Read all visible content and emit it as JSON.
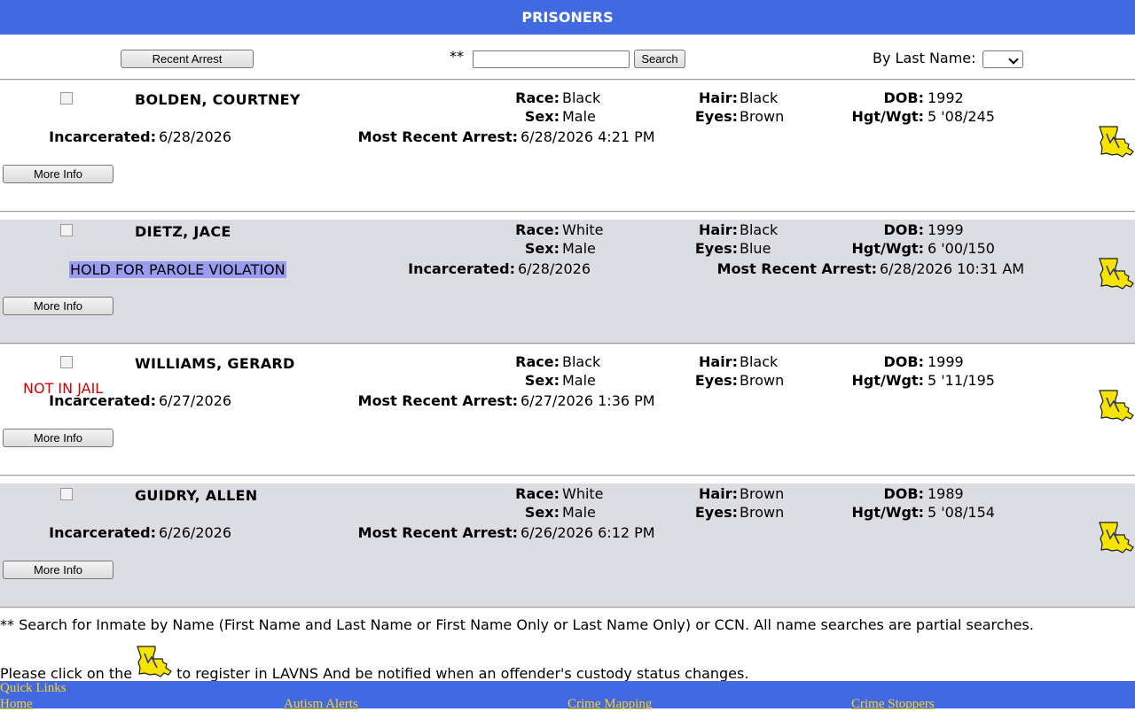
{
  "page_title": "PRISONERS",
  "toolbar": {
    "recent_arrest_label": "Recent Arrest",
    "asterisks": "**",
    "search_value": "",
    "search_button_label": "Search",
    "by_last_name_label": "By Last Name:",
    "last_name_selected": ""
  },
  "labels": {
    "race": "Race:",
    "sex": "Sex:",
    "hair": "Hair:",
    "eyes": "Eyes:",
    "dob": "DOB:",
    "hgt_wgt": "Hgt/Wgt:",
    "incarcerated": "Incarcerated:",
    "most_recent_arrest": "Most Recent Arrest:",
    "more_info": "More Info"
  },
  "records": [
    {
      "name": "BOLDEN, COURTNEY",
      "race": "Black",
      "sex": "Male",
      "hair": "Black",
      "eyes": "Brown",
      "dob": "1992",
      "hgt_wgt": "5 '08/245",
      "incarcerated": "6/28/2026",
      "most_recent_arrest": "6/28/2026 4:21 PM"
    },
    {
      "name": "DIETZ, JACE",
      "race": "White",
      "sex": "Male",
      "hair": "Black",
      "eyes": "Blue",
      "dob": "1999",
      "hgt_wgt": "6 '00/150",
      "status": "HOLD FOR PAROLE VIOLATION",
      "incarcerated": "6/28/2026",
      "most_recent_arrest": "6/28/2026 10:31 AM"
    },
    {
      "name": "WILLIAMS, GERARD",
      "race": "Black",
      "sex": "Male",
      "hair": "Black",
      "eyes": "Brown",
      "dob": "1999",
      "hgt_wgt": "5 '11/195",
      "status": "NOT IN JAIL",
      "incarcerated": "6/27/2026",
      "most_recent_arrest": "6/27/2026 1:36 PM"
    },
    {
      "name": "GUIDRY, ALLEN",
      "race": "White",
      "sex": "Male",
      "hair": "Brown",
      "eyes": "Brown",
      "dob": "1989",
      "hgt_wgt": "5 '08/154",
      "incarcerated": "6/26/2026",
      "most_recent_arrest": "6/26/2026 6:12 PM"
    }
  ],
  "footer": {
    "search_note": "** Search for Inmate by Name (First Name and Last Name or First Name Only or Last Name Only) or CCN. All name searches are partial searches.",
    "register_prefix": "Please click on the",
    "register_suffix": "to register in LAVNS And be notified when an offender's custody status changes."
  },
  "quick_links": {
    "title": "Quick Links",
    "links": [
      "Home",
      "Autism Alerts",
      "Crime Mapping",
      "Crime Stoppers"
    ]
  },
  "icons": {
    "lavns": "louisiana-state-icon"
  },
  "colors": {
    "header_bg": "#4169e1",
    "row_shade": "#dcdde3",
    "link": "#ffd21f",
    "not_in_jail": "#d40000",
    "highlight": "#9b9bf0"
  }
}
